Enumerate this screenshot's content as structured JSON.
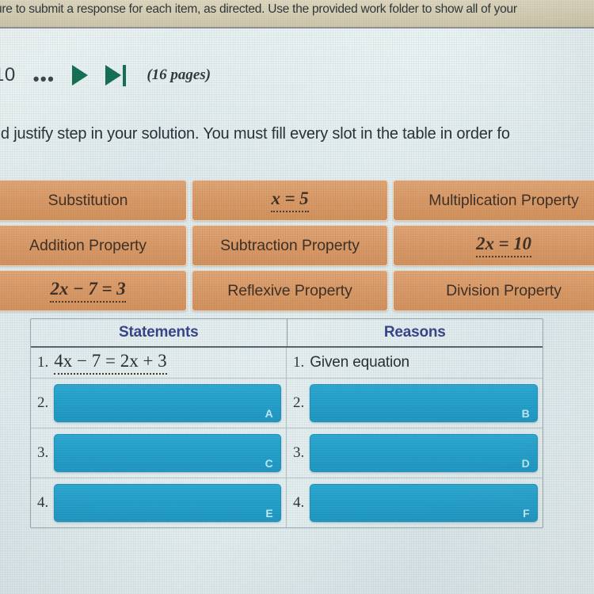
{
  "colors": {
    "tile_orange": "#df9c67",
    "slot_blue": "#1b9cc9",
    "header_navy": "#333f86",
    "nav_green": "#116b4e",
    "band_tan": "#d7cdb2",
    "page_bg": "#e3eced"
  },
  "top_band": {
    "text": "ure to submit a response for each item, as directed. Use the provided work folder to show all of your"
  },
  "nav": {
    "page_number": "10",
    "ellipsis": "•••",
    "next_page_icon": "play-triangle-icon",
    "last_page_icon": "skip-to-end-icon",
    "pages_label": "(16 pages)"
  },
  "instruction": {
    "text": "nd justify step in your solution. You must fill every slot in the table in order fo"
  },
  "tile_bank": {
    "rows": [
      [
        {
          "label": "Substitution",
          "kind": "text"
        },
        {
          "label": "x = 5",
          "kind": "math"
        },
        {
          "label": "Multiplication Property",
          "kind": "text"
        }
      ],
      [
        {
          "label": "Addition Property",
          "kind": "text"
        },
        {
          "label": "Subtraction Property",
          "kind": "text"
        },
        {
          "label": "2x = 10",
          "kind": "math"
        }
      ],
      [
        {
          "label": "2x − 7 = 3",
          "kind": "math"
        },
        {
          "label": "Reflexive Property",
          "kind": "text"
        },
        {
          "label": "Division Property",
          "kind": "text"
        }
      ]
    ]
  },
  "proof_table": {
    "headers": {
      "statements": "Statements",
      "reasons": "Reasons"
    },
    "rows": [
      {
        "number_left": "1.",
        "statement": "4x − 7 = 2x + 3",
        "number_right": "1.",
        "reason": "Given equation",
        "filled": true
      },
      {
        "number_left": "2.",
        "left_slot_letter": "A",
        "number_right": "2.",
        "right_slot_letter": "B",
        "filled": false
      },
      {
        "number_left": "3.",
        "left_slot_letter": "C",
        "number_right": "3.",
        "right_slot_letter": "D",
        "filled": false
      },
      {
        "number_left": "4.",
        "left_slot_letter": "E",
        "number_right": "4.",
        "right_slot_letter": "F",
        "filled": false
      }
    ]
  }
}
